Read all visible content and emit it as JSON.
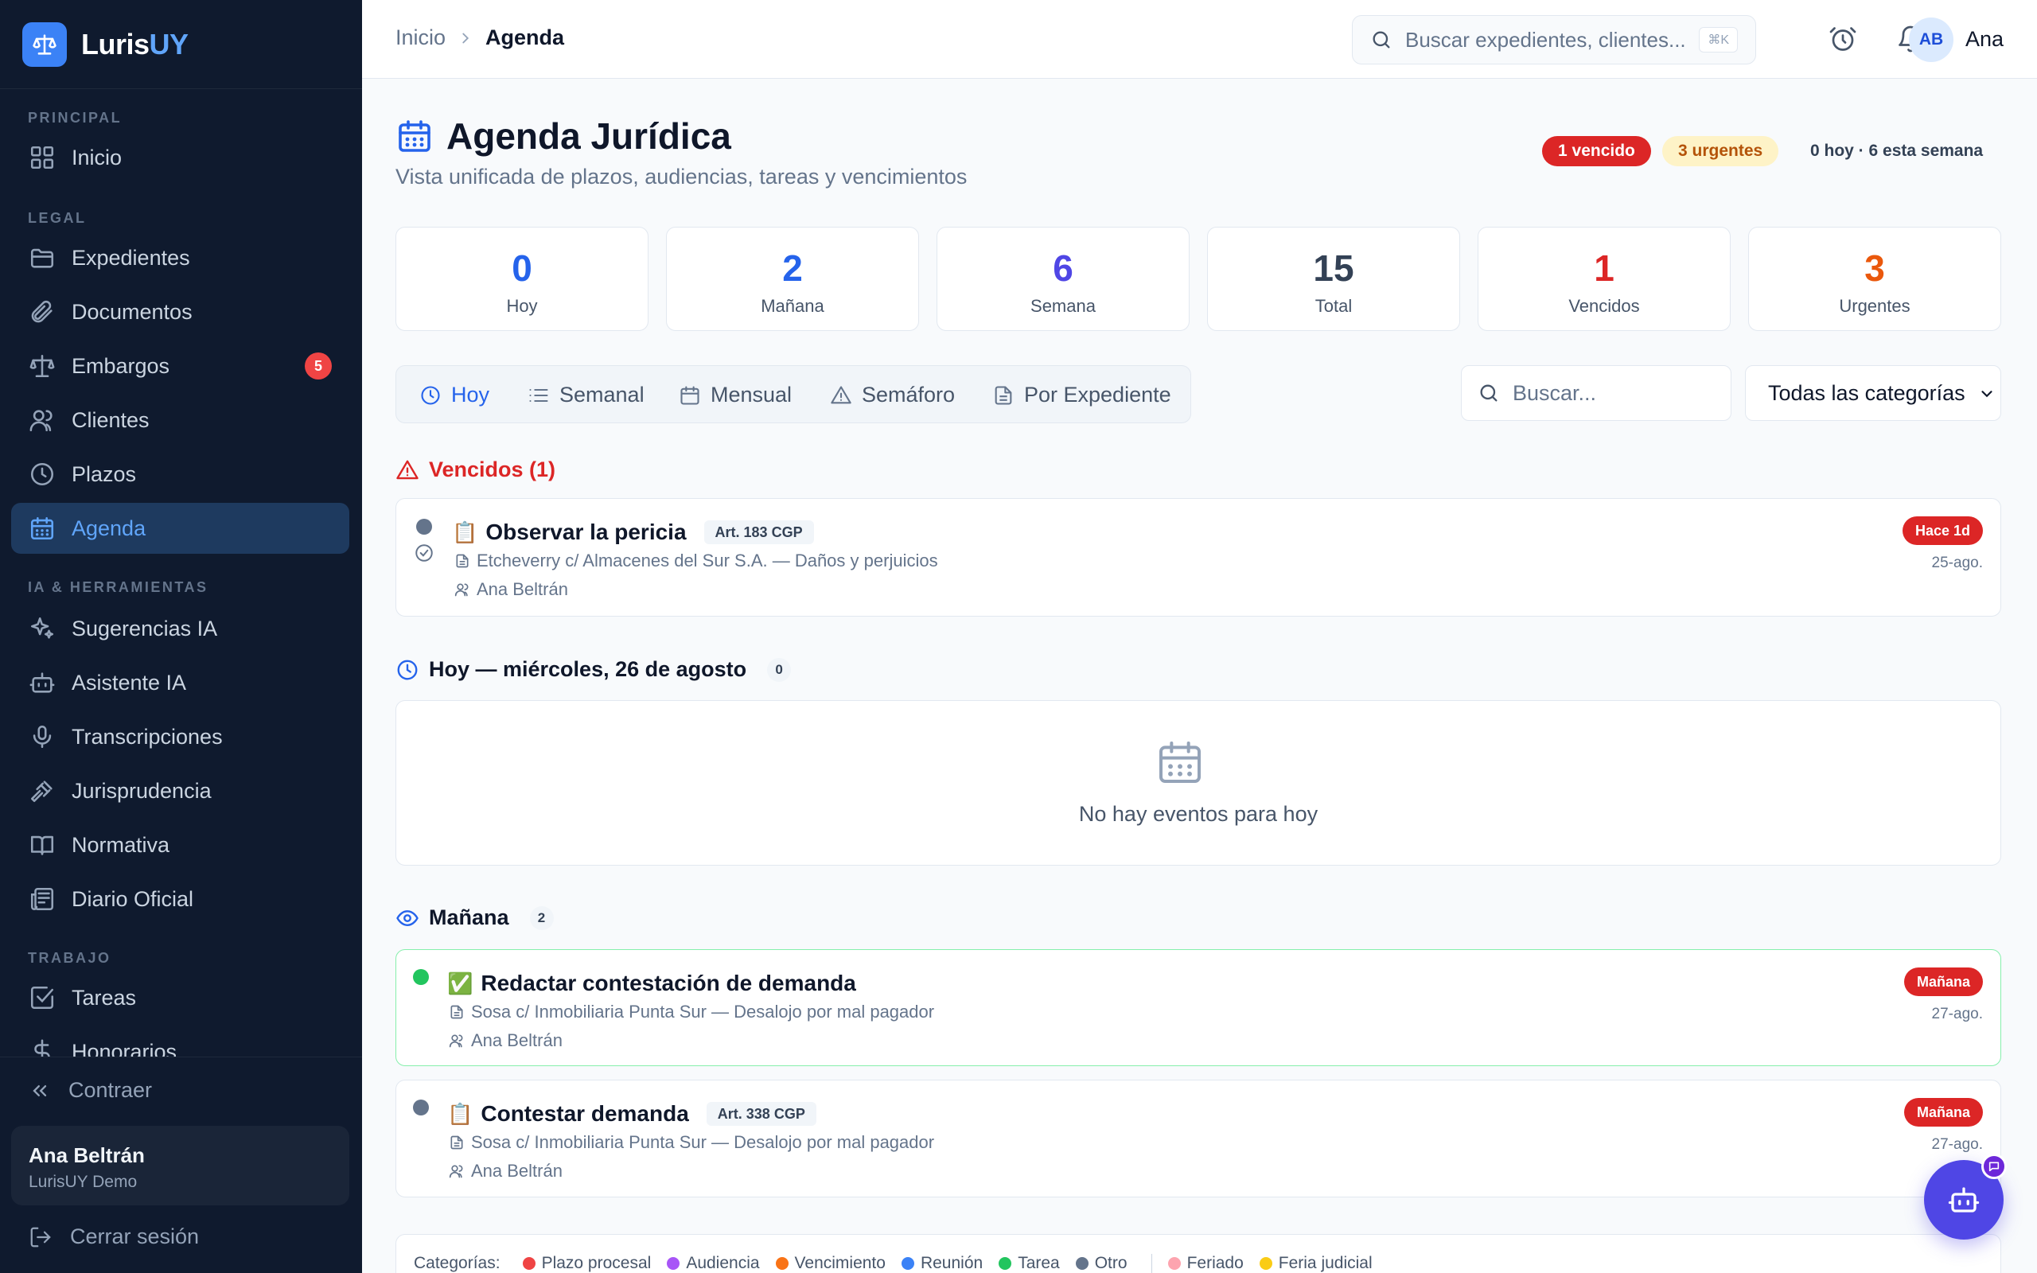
{
  "brand": {
    "name_main": "Luris",
    "name_accent": "UY"
  },
  "sidebar": {
    "sections": {
      "principal": "PRINCIPAL",
      "legal": "LEGAL",
      "ia": "IA & HERRAMIENTAS",
      "trabajo": "TRABAJO"
    },
    "items": [
      {
        "label": "Inicio",
        "icon": "grid-icon"
      },
      {
        "label": "Expedientes",
        "icon": "folder-icon"
      },
      {
        "label": "Documentos",
        "icon": "paperclip-icon"
      },
      {
        "label": "Embargos",
        "icon": "scale-icon",
        "badge": "5"
      },
      {
        "label": "Clientes",
        "icon": "users-icon"
      },
      {
        "label": "Plazos",
        "icon": "clock-icon"
      },
      {
        "label": "Agenda",
        "icon": "calendar-icon",
        "active": true
      },
      {
        "label": "Sugerencias IA",
        "icon": "sparkles-icon"
      },
      {
        "label": "Asistente IA",
        "icon": "bot-icon"
      },
      {
        "label": "Transcripciones",
        "icon": "mic-icon"
      },
      {
        "label": "Jurisprudencia",
        "icon": "gavel-icon"
      },
      {
        "label": "Normativa",
        "icon": "book-icon"
      },
      {
        "label": "Diario Oficial",
        "icon": "newspaper-icon"
      },
      {
        "label": "Tareas",
        "icon": "check-square-icon"
      },
      {
        "label": "Honorarios",
        "icon": "dollar-icon"
      }
    ],
    "collapse_label": "Contraer",
    "user": {
      "name": "Ana Beltrán",
      "org": "LurisUY Demo"
    },
    "logout_label": "Cerrar sesión"
  },
  "topbar": {
    "breadcrumb": {
      "home": "Inicio",
      "current": "Agenda"
    },
    "search_placeholder": "Buscar expedientes, clientes...",
    "shortcut": "⌘K",
    "avatar_initials": "AB",
    "user_short": "Ana"
  },
  "page": {
    "title": "Agenda Jurídica",
    "subtitle": "Vista unificada de plazos, audiencias, tareas y vencimientos",
    "pills": {
      "overdue": "1 vencido",
      "urgent": "3 urgentes",
      "summary": "0 hoy · 6 esta semana"
    }
  },
  "stats": [
    {
      "value": "0",
      "label": "Hoy",
      "color": "#2563eb"
    },
    {
      "value": "2",
      "label": "Mañana",
      "color": "#2563eb"
    },
    {
      "value": "6",
      "label": "Semana",
      "color": "#4f46e5"
    },
    {
      "value": "15",
      "label": "Total",
      "color": "#334155"
    },
    {
      "value": "1",
      "label": "Vencidos",
      "color": "#dc2626"
    },
    {
      "value": "3",
      "label": "Urgentes",
      "color": "#ea580c"
    }
  ],
  "tabs": [
    {
      "label": "Hoy",
      "icon": "clock-icon",
      "active": true
    },
    {
      "label": "Semanal",
      "icon": "list-icon"
    },
    {
      "label": "Mensual",
      "icon": "calendar-icon"
    },
    {
      "label": "Semáforo",
      "icon": "warning-icon"
    },
    {
      "label": "Por Expediente",
      "icon": "file-icon"
    }
  ],
  "filters": {
    "search_placeholder": "Buscar...",
    "category_selected": "Todas las categorías"
  },
  "sections": {
    "vencidos": {
      "title": "Vencidos (1)",
      "events": [
        {
          "emoji": "📋",
          "title": "Observar la pericia",
          "article": "Art. 183 CGP",
          "case": "Etcheverry c/ Almacenes del Sur S.A. — Daños y perjuicios",
          "assignee": "Ana Beltrán",
          "badge": "Hace 1d",
          "date": "25-ago."
        }
      ]
    },
    "hoy": {
      "title": "Hoy — miércoles, 26 de agosto",
      "count": "0",
      "empty_text": "No hay eventos para hoy"
    },
    "manana": {
      "title": "Mañana",
      "count": "2",
      "events": [
        {
          "emoji": "✅",
          "title": "Redactar contestación de demanda",
          "case": "Sosa c/ Inmobiliaria Punta Sur — Desalojo por mal pagador",
          "assignee": "Ana Beltrán",
          "badge": "Mañana",
          "date": "27-ago."
        },
        {
          "emoji": "📋",
          "title": "Contestar demanda",
          "article": "Art. 338 CGP",
          "case": "Sosa c/ Inmobiliaria Punta Sur — Desalojo por mal pagador",
          "assignee": "Ana Beltrán",
          "badge": "Mañana",
          "date": "27-ago."
        }
      ]
    }
  },
  "legend": {
    "title": "Categorías:",
    "items": [
      {
        "label": "Plazo procesal",
        "color": "#ef4444"
      },
      {
        "label": "Audiencia",
        "color": "#a855f7"
      },
      {
        "label": "Vencimiento",
        "color": "#f97316"
      },
      {
        "label": "Reunión",
        "color": "#3b82f6"
      },
      {
        "label": "Tarea",
        "color": "#22c55e"
      },
      {
        "label": "Otro",
        "color": "#64748b"
      }
    ],
    "extra": [
      {
        "label": "Feriado",
        "color": "#fda4af"
      },
      {
        "label": "Feria judicial",
        "color": "#facc15"
      }
    ]
  }
}
